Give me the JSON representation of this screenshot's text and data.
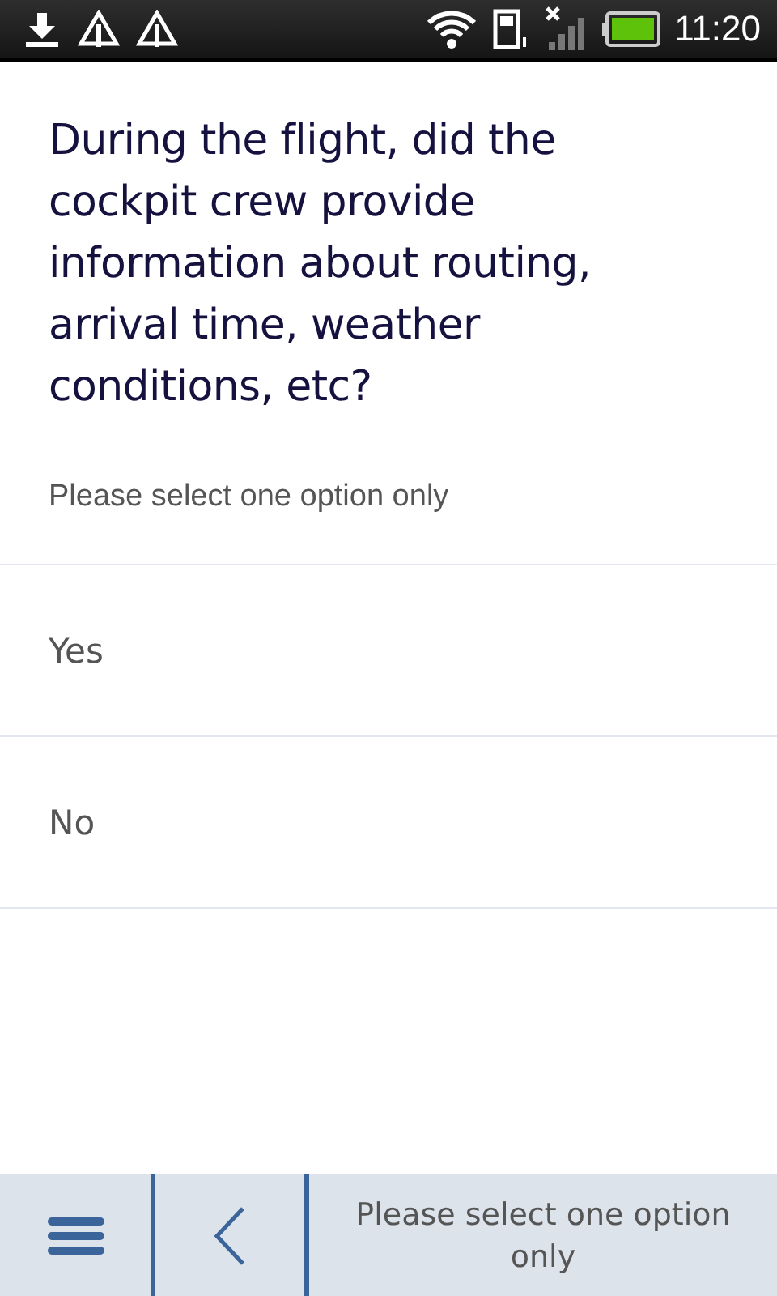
{
  "status_bar": {
    "time": "11:20"
  },
  "question": "During the flight, did the cockpit crew provide information about routing, arrival time, weather conditions, etc?",
  "hint": "Please select one option only",
  "options": [
    {
      "label": "Yes",
      "selected": false
    },
    {
      "label": "No",
      "selected": false
    }
  ],
  "bottom_bar": {
    "message": "Please select one option only"
  }
}
